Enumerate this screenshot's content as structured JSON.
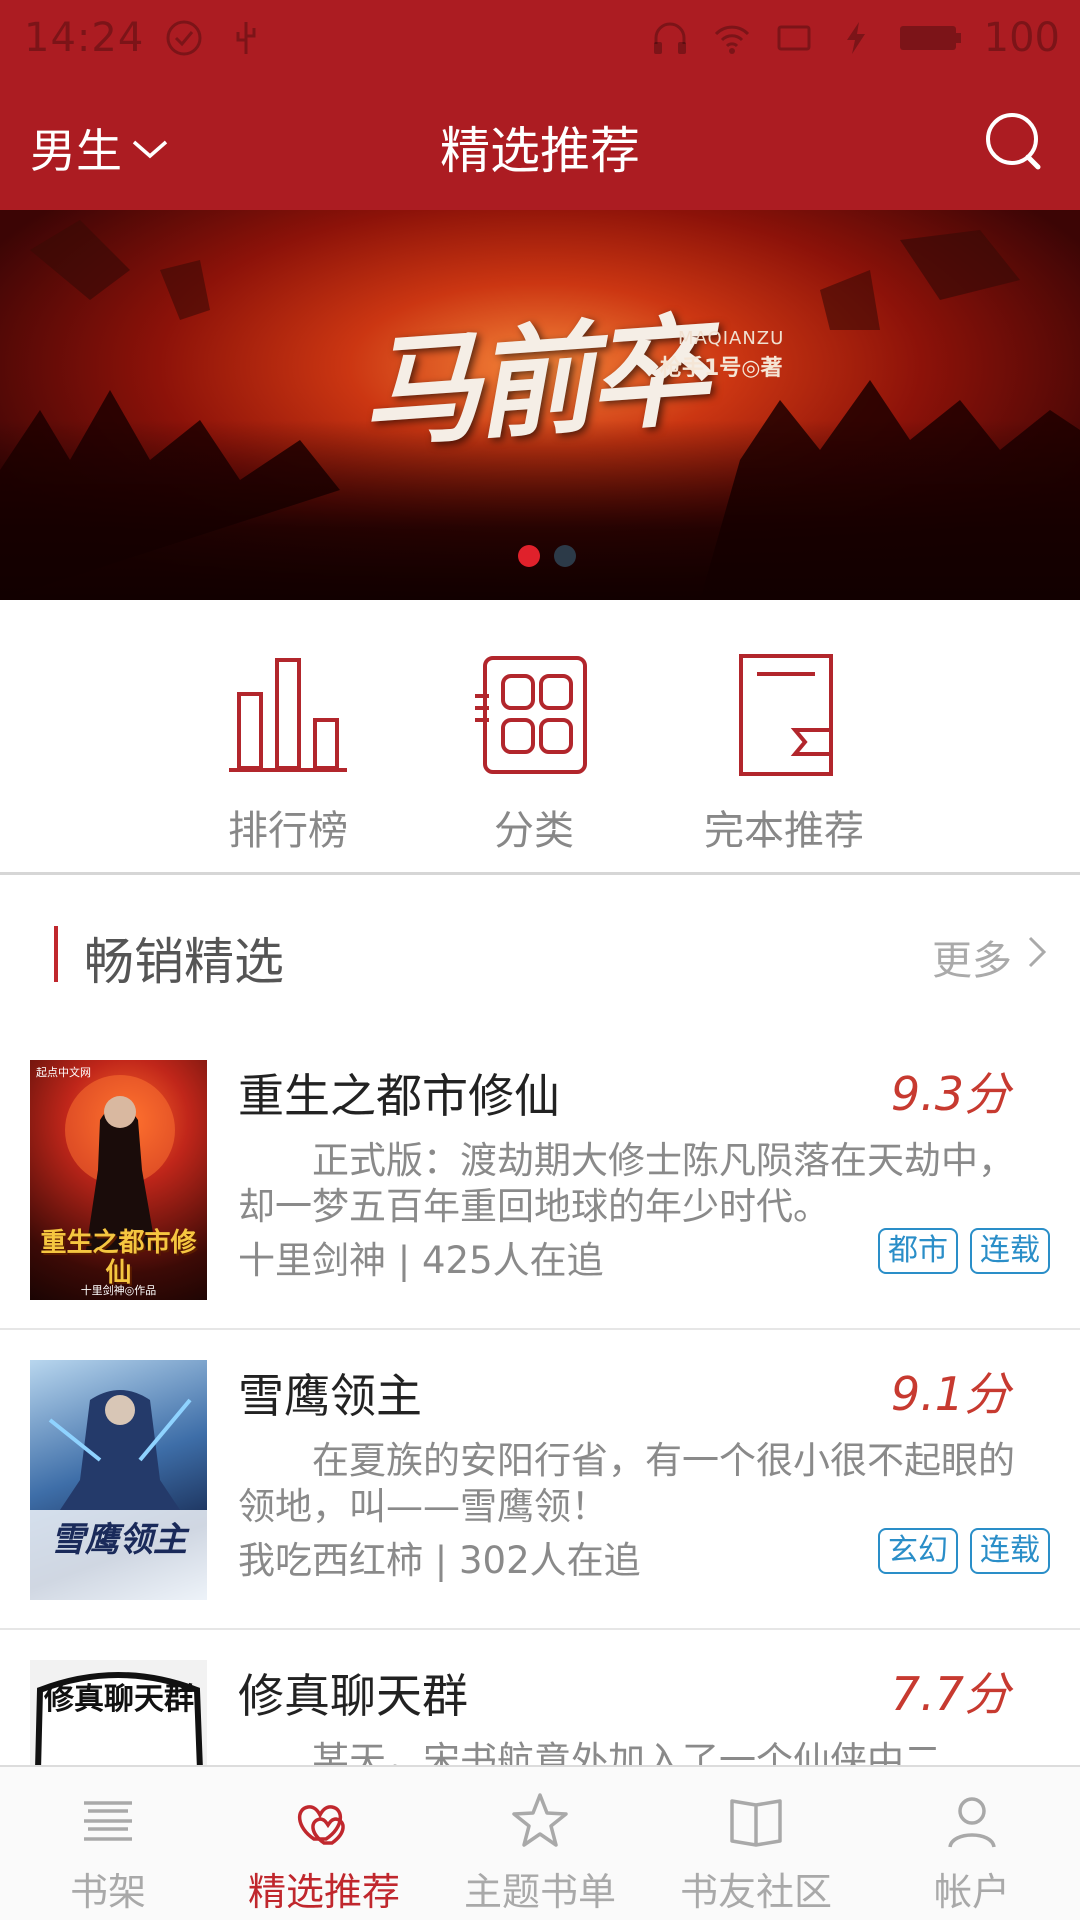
{
  "status_bar": {
    "time": "14:24",
    "battery": "100",
    "icons": [
      "check-circle-icon",
      "usb-icon",
      "headphones-icon",
      "wifi-icon",
      "screen-icon",
      "charging-icon",
      "battery-icon"
    ]
  },
  "header": {
    "gender_selector": "男生",
    "title": "精选推荐",
    "search_icon": "search-icon",
    "accent_color": "#ac1c22"
  },
  "banner": {
    "title_calligraphy": "马前卒",
    "subtitle_latin": "MAQIANZU",
    "author": "枪手1号◎著",
    "slide_count": 2,
    "active_slide": 1
  },
  "quick_nav": [
    {
      "label": "排行榜",
      "icon": "bar-chart-icon"
    },
    {
      "label": "分类",
      "icon": "category-grid-icon"
    },
    {
      "label": "完本推荐",
      "icon": "book-complete-icon"
    }
  ],
  "section": {
    "title": "畅销精选",
    "more_label": "更多"
  },
  "books": [
    {
      "title": "重生之都市修仙",
      "score": "9.3分",
      "description": "正式版：渡劫期大修士陈凡陨落在天劫中，却一梦五百年重回地球的年少时代。",
      "meta": "十里剑神 | 425人在追",
      "tags": [
        "都市",
        "连载"
      ],
      "cover_text": "重生之都市修仙",
      "cover_caption": "十里剑神◎作品",
      "cover_publisher": "起点中文网"
    },
    {
      "title": "雪鹰领主",
      "score": "9.1分",
      "description": "在夏族的安阳行省，有一个很小很不起眼的领地，叫——雪鹰领！",
      "meta": "我吃西红柿 | 302人在追",
      "tags": [
        "玄幻",
        "连载"
      ],
      "cover_text": "雪鹰领主"
    },
    {
      "title": "修真聊天群",
      "score": "7.7分",
      "description": "某天，宋书航意外加入了一个仙侠中二",
      "cover_text": "修真聊天群"
    }
  ],
  "bottom_nav": [
    {
      "label": "书架",
      "icon": "bookshelf-icon",
      "active": false
    },
    {
      "label": "精选推荐",
      "icon": "hearts-icon",
      "active": true
    },
    {
      "label": "主题书单",
      "icon": "star-icon",
      "active": false
    },
    {
      "label": "书友社区",
      "icon": "open-book-icon",
      "active": false
    },
    {
      "label": "帐户",
      "icon": "user-icon",
      "active": false
    }
  ]
}
